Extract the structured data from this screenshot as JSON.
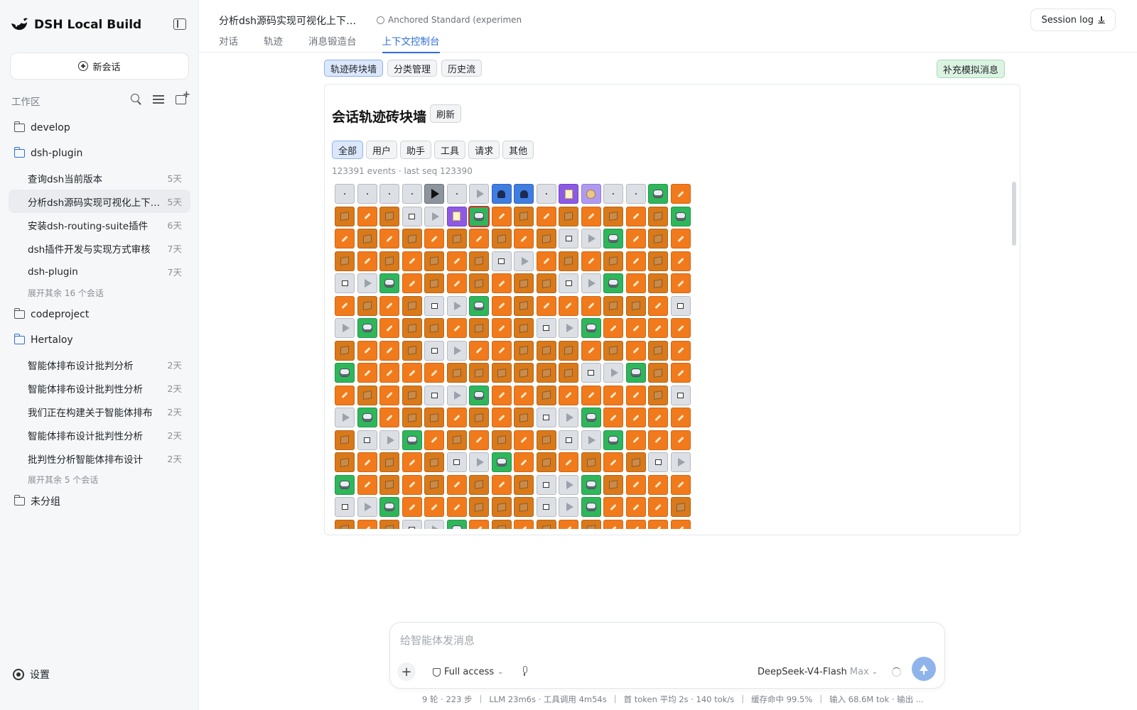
{
  "app": {
    "title": "DSH Local Build"
  },
  "sidebar": {
    "new_chat_label": "新会话",
    "workspace_label": "工作区",
    "groups": [
      {
        "name": "develop",
        "open": false,
        "sessions": [],
        "more": ""
      },
      {
        "name": "dsh-plugin",
        "open": true,
        "sessions": [
          {
            "title": "查询dsh当前版本",
            "age": "5天",
            "active": false
          },
          {
            "title": "分析dsh源码实现可视化上下文…",
            "age": "5天",
            "active": true
          },
          {
            "title": "安装dsh-routing-suite插件",
            "age": "6天",
            "active": false
          },
          {
            "title": "dsh插件开发与实现方式审核",
            "age": "7天",
            "active": false
          },
          {
            "title": "dsh-plugin",
            "age": "7天",
            "active": false
          }
        ],
        "more": "展开其余 16 个会话"
      },
      {
        "name": "codeproject",
        "open": false,
        "sessions": [],
        "more": ""
      },
      {
        "name": "Hertaloy",
        "open": true,
        "sessions": [
          {
            "title": "智能体排布设计批判分析",
            "age": "2天",
            "active": false
          },
          {
            "title": "智能体排布设计批判性分析",
            "age": "2天",
            "active": false
          },
          {
            "title": "我们正在构建关于智能体排布",
            "age": "2天",
            "active": false
          },
          {
            "title": "智能体排布设计批判性分析",
            "age": "2天",
            "active": false
          },
          {
            "title": "批判性分析智能体排布设计",
            "age": "2天",
            "active": false
          }
        ],
        "more": "展开其余 5 个会话"
      },
      {
        "name": "未分组",
        "open": false,
        "sessions": [],
        "more": ""
      }
    ],
    "settings_label": "设置"
  },
  "header": {
    "session_title": "分析dsh源码实现可视化上下文…",
    "mode": "Anchored Standard (experimen",
    "tabs": [
      "对话",
      "轨迹",
      "消息锻造台",
      "上下文控制台"
    ],
    "active_tab": 3,
    "session_log_label": "Session log"
  },
  "console": {
    "views": [
      "轨迹砖块墙",
      "分类管理",
      "历史流"
    ],
    "active_view": 0,
    "supplement_label": "补充模拟消息",
    "panel_title": "会话轨迹砖块墙",
    "refresh_label": "刷新",
    "filters": [
      "全部",
      "用户",
      "助手",
      "工具",
      "请求",
      "其他"
    ],
    "active_filter": 0,
    "meta": "123391 events · last seq 123390"
  },
  "brick_legend": {
    "o": {
      "icon": "wrench-icon",
      "color": "#f07a1c"
    },
    "d": {
      "icon": "package-icon",
      "color": "#d9791a"
    },
    "g": {
      "icon": "square-icon",
      "color": "#dcdfe4"
    },
    "p": {
      "icon": "play-icon",
      "color": "#dcdfe4"
    },
    "r": {
      "icon": "robot-icon",
      "color": "#2fb65b"
    },
    "u": {
      "icon": "user-icon",
      "color": "#3f7de0"
    },
    "n": {
      "icon": "note-icon",
      "color": "#8d5ae6"
    },
    "c": {
      "icon": "clock-icon",
      "color": "#b09af0"
    },
    "x": {
      "icon": "dot-icon",
      "color": "#dcdfe4"
    },
    "k": {
      "icon": "play-dark-icon",
      "color": "#8d949e"
    }
  },
  "bricks": [
    "xxxxkxpuuxncxxro",
    "dodgpnrododododr",
    "odododododgprodo",
    "dodododgpodododo",
    "gprodododdgprodo",
    "ododgprodoooddog",
    "proddododgproooo",
    "doodgpoodddododo",
    "rooooddddddgprdo",
    "ododgproodoooodg",
    "proddododgproooo",
    "dgprodododgprooo",
    "dododgprodododgp",
    "rododododgprdooo",
    "gprooodddgproood",
    "dodgprodododoooo"
  ],
  "selected_brick": {
    "row": 1,
    "col": 6
  },
  "composer": {
    "placeholder": "给智能体发消息",
    "access_label": "Full access",
    "model_name": "DeepSeek-V4-Flash",
    "model_tier": "Max"
  },
  "status": [
    "9 轮 · 223 步",
    "LLM 23m6s · 工具调用 4m54s",
    "首 token 平均 2s · 140 tok/s",
    "缓存命中 99.5%",
    "输入 68.6M tok · 输出 ..."
  ]
}
